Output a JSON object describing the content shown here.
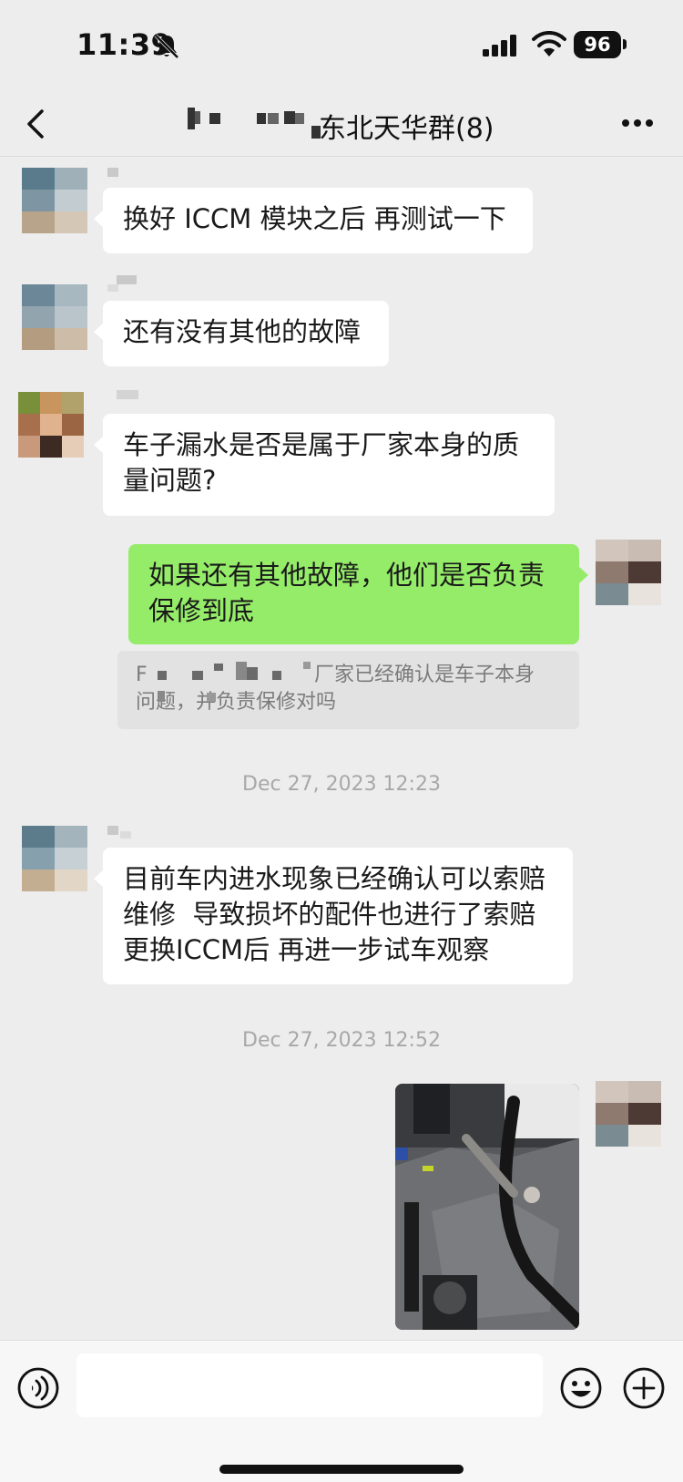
{
  "status_bar": {
    "time": "11:39",
    "battery": "96"
  },
  "header": {
    "title": "东北天华群(8)"
  },
  "messages": [
    {
      "text": "换好 ICCM 模块之后 再测试一下"
    },
    {
      "text": "还有没有其他的故障"
    },
    {
      "text": "车子漏水是否是属于厂家本身的质量问题?"
    },
    {
      "text": "如果还有其他故障，他们是否负责保修到底"
    },
    {
      "text": "目前车内进水现象已经确认可以索赔维修  导致损坏的配件也进行了索赔   更换ICCM后 再进一步试车观察"
    }
  ],
  "quote": {
    "prefix": "F",
    "line1": "厂家已经确认是车子本身",
    "line2": "问题，并负责保修对吗"
  },
  "timestamps": [
    "Dec 27, 2023 12:23",
    "Dec 27, 2023 12:52"
  ],
  "input": {
    "placeholder": ""
  },
  "icons": {
    "back": "chevron-left-icon",
    "more": "ellipsis-icon",
    "voice": "voice-icon",
    "emoji": "emoji-icon",
    "plus": "plus-icon",
    "bell_muted": "bell-slash-icon",
    "signal": "signal-icon",
    "wifi": "wifi-icon"
  },
  "colors": {
    "background": "#ededed",
    "outgoing_bubble": "#95ec69",
    "incoming_bubble": "#ffffff"
  }
}
